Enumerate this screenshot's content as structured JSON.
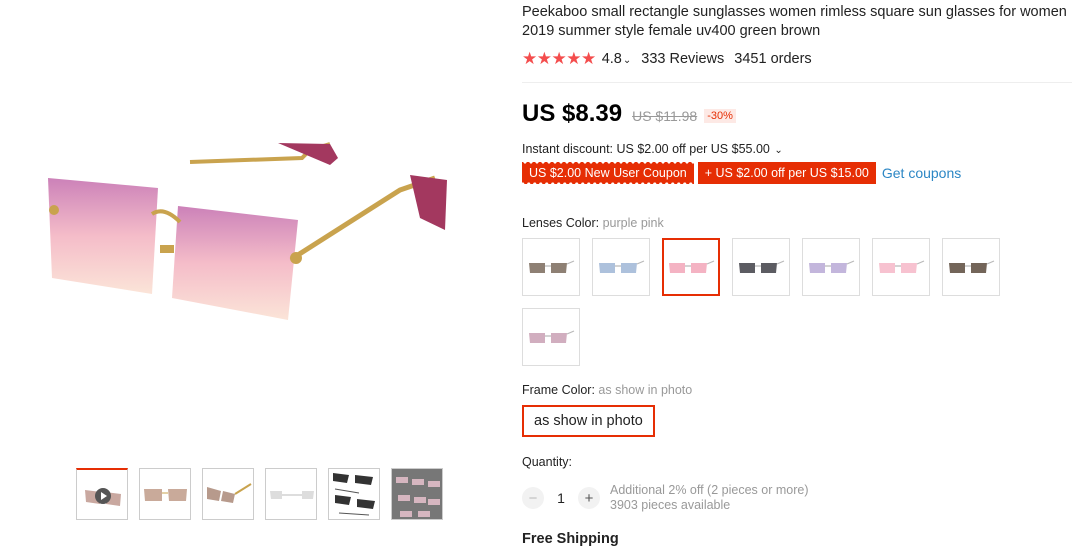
{
  "product": {
    "title": "Peekaboo small rectangle sunglasses women rimless square sun glasses for women 2019 summer style female uv400 green brown",
    "rating": "4.8",
    "reviews": "333 Reviews",
    "orders": "3451 orders",
    "stars": "★★★★★"
  },
  "price": {
    "current": "US $8.39",
    "original": "US $11.98",
    "discount": "-30%"
  },
  "promotions": {
    "instant_discount": "Instant discount: US $2.00 off per US $55.00",
    "new_user_coupon": "US $2.00 New User Coupon",
    "store_coupon": "+ US $2.00 off per US $15.00",
    "get_coupons": "Get coupons"
  },
  "lenses": {
    "label": "Lenses Color:",
    "selected": "purple pink",
    "swatch_colors": [
      "#7a6a5c",
      "#9fb6d6",
      "#f2a6b8",
      "#3f3f46",
      "#b9a9d6",
      "#f6b7c8",
      "#5a4a3c",
      "#c9a0b4"
    ],
    "selected_index": 2
  },
  "frame": {
    "label": "Frame Color:",
    "selected": "as show in photo",
    "option": "as show in photo"
  },
  "quantity": {
    "label": "Quantity:",
    "value": "1",
    "minus": "−",
    "plus": "+",
    "bulk_offer": "Additional 2% off (2 pieces or more)",
    "available": "3903 pieces available"
  },
  "shipping": {
    "label": "Free Shipping"
  },
  "colors": {
    "accent": "#e62e04",
    "link": "#2c87c5",
    "star": "#f44d4d"
  },
  "icons": {
    "video": "play-icon",
    "dropdown": "chevron-down-icon"
  }
}
